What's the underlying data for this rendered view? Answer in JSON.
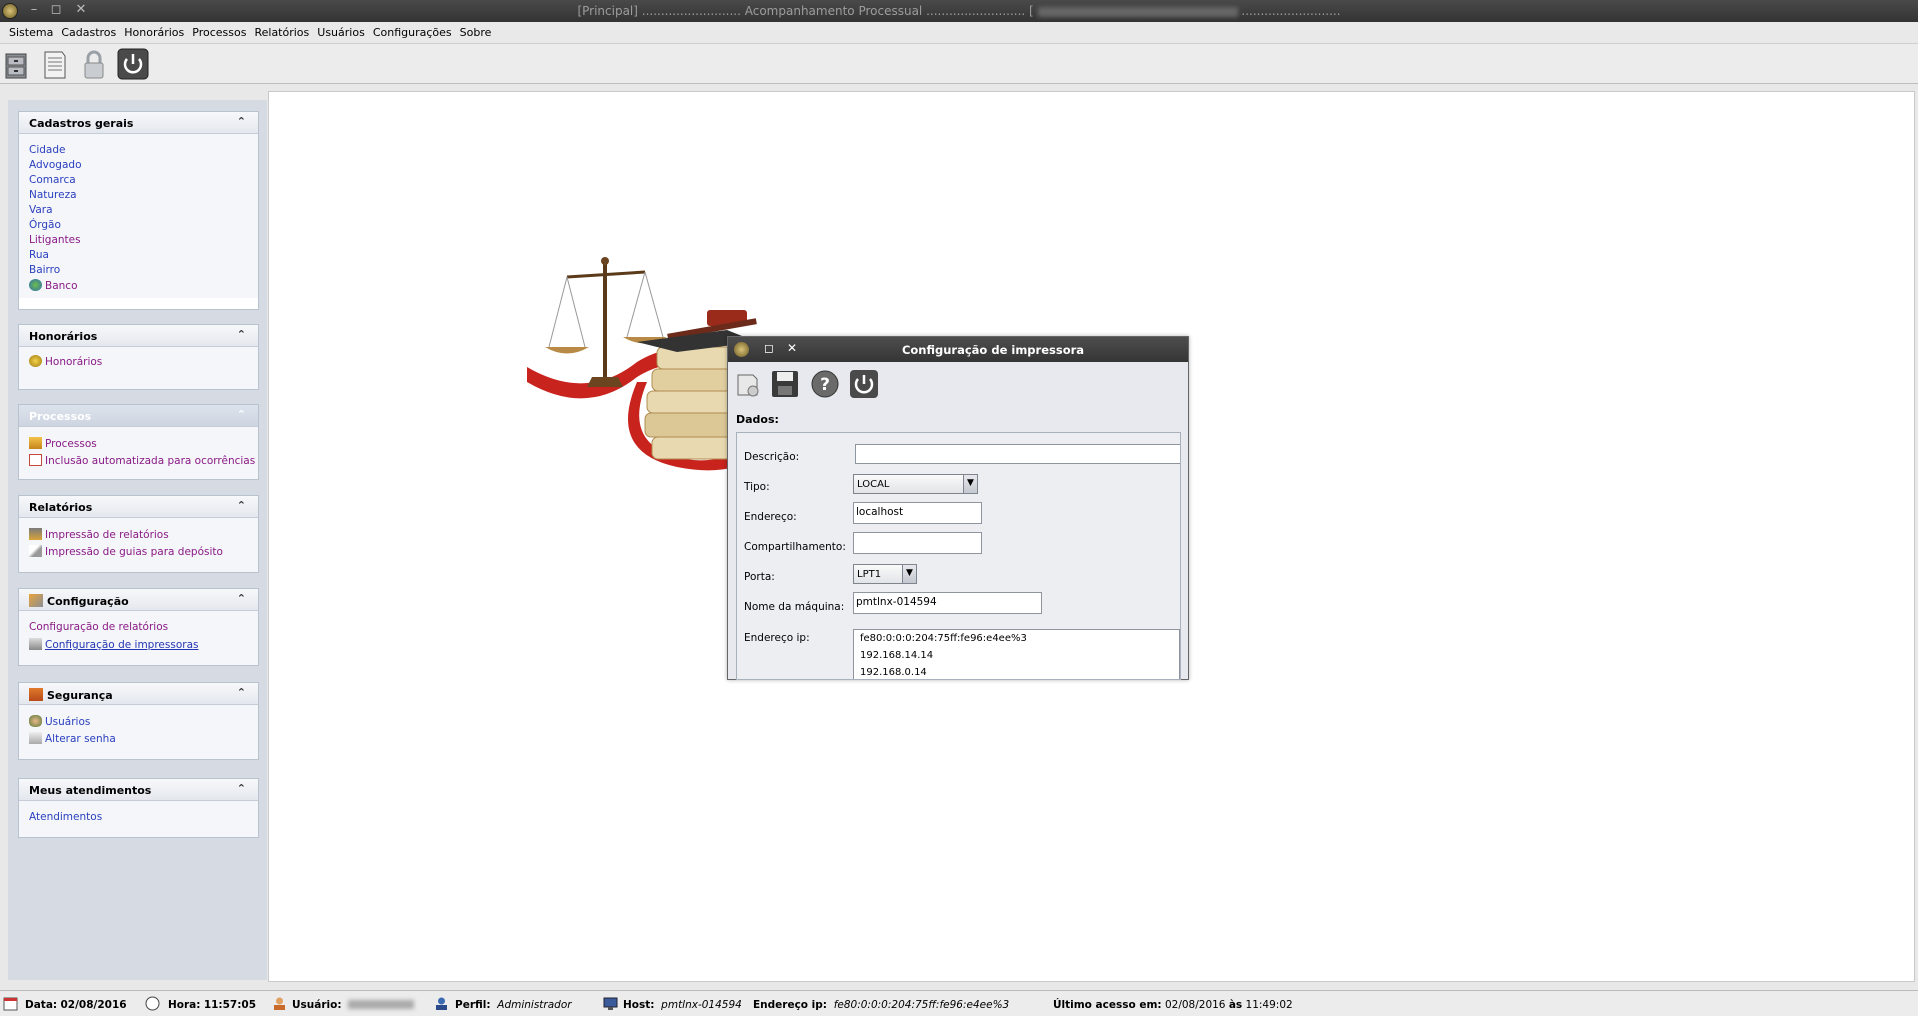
{
  "titlebar": {
    "title": "[Principal] .......................... Acompanhamento Processual .......................... [ ",
    "title_suffix": " .........................."
  },
  "menu": [
    "Sistema",
    "Cadastros",
    "Honorários",
    "Processos",
    "Relatórios",
    "Usuários",
    "Configurações",
    "Sobre"
  ],
  "sidebar": {
    "panels": [
      {
        "title": "Cadastros gerais",
        "items": [
          "Cidade",
          "Advogado",
          "Comarca",
          "Natureza",
          "Vara",
          "Órgão",
          "Litigantes",
          "Rua",
          "Bairro",
          "Banco"
        ]
      },
      {
        "title": "Honorários",
        "items": [
          "Honorários"
        ]
      },
      {
        "title": "Processos",
        "items": [
          "Processos",
          "Inclusão automatizada para ocorrências"
        ]
      },
      {
        "title": "Relatórios",
        "items": [
          "Impressão de relatórios",
          "Impressão de guias para depósito"
        ]
      },
      {
        "title": "Configuração",
        "items": [
          "Configuração de relatórios",
          "Configuração de impressoras"
        ]
      },
      {
        "title": "Segurança",
        "items": [
          "Usuários",
          "Alterar senha"
        ]
      },
      {
        "title": "Meus atendimentos",
        "items": [
          "Atendimentos"
        ]
      }
    ]
  },
  "dialog": {
    "title": "Configuração de impressora",
    "section": "Dados:",
    "labels": {
      "descricao": "Descrição:",
      "tipo": "Tipo:",
      "endereco": "Endereço:",
      "compartilhamento": "Compartilhamento:",
      "porta": "Porta:",
      "nome_maquina": "Nome da máquina:",
      "endereco_ip": "Endereço ip:"
    },
    "values": {
      "descricao": "",
      "tipo": "LOCAL",
      "endereco": "localhost",
      "compartilhamento": "",
      "porta": "LPT1",
      "nome_maquina": "pmtlnx-014594"
    },
    "ip_list": [
      "fe80:0:0:0:204:75ff:fe96:e4ee%3",
      "192.168.14.14",
      "192.168.0.14"
    ]
  },
  "status": {
    "data_label": "Data:",
    "data_value": "02/08/2016",
    "hora_label": "Hora:",
    "hora_value": "11:57:05",
    "usuario_label": "Usuário:",
    "perfil_label": "Perfil:",
    "perfil_value": "Administrador",
    "host_label": "Host:",
    "host_value": "pmtlnx-014594",
    "ip_label": "Endereço ip:",
    "ip_value": "fe80:0:0:0:204:75ff:fe96:e4ee%3",
    "ultimo_label": "Último acesso em:",
    "ultimo_date": "02/08/2016",
    "as_label": "às",
    "ultimo_time": "11:49:02"
  }
}
